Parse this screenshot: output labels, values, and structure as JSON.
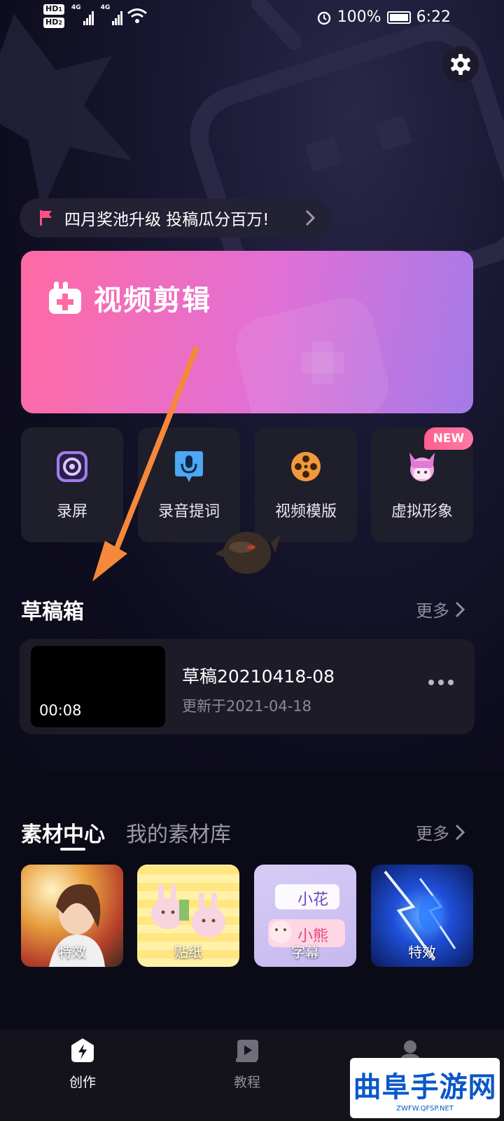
{
  "status_bar": {
    "hd1": "HD",
    "hd1_sub": "1",
    "hd2": "HD",
    "hd2_sub": "2",
    "net1": "4G",
    "net2": "4G",
    "battery": "100%",
    "time": "6:22"
  },
  "banner": {
    "text": "四月奖池升级 投稿瓜分百万!"
  },
  "edit_card": {
    "title": "视频剪辑"
  },
  "tools": [
    {
      "label": "录屏",
      "icon": "screen-record-icon"
    },
    {
      "label": "录音提词",
      "icon": "microphone-icon"
    },
    {
      "label": "视频模版",
      "icon": "film-reel-icon"
    },
    {
      "label": "虚拟形象",
      "icon": "avatar-icon",
      "badge": "NEW"
    }
  ],
  "drafts": {
    "title": "草稿箱",
    "more": "更多",
    "items": [
      {
        "name": "草稿20210418-08",
        "updated": "更新于2021-04-18",
        "duration": "00:08"
      }
    ]
  },
  "materials": {
    "tab_active": "素材中心",
    "tab_inactive": "我的素材库",
    "more": "更多",
    "items": [
      {
        "label": "特效"
      },
      {
        "label": "贴纸"
      },
      {
        "label": "字幕"
      },
      {
        "label": "特效"
      }
    ],
    "sticker_text_1": "小花",
    "sticker_text_2": "小熊"
  },
  "bottom_nav": [
    {
      "label": "创作",
      "icon": "lightning-icon",
      "active": true
    },
    {
      "label": "教程",
      "icon": "play-book-icon",
      "active": false
    }
  ],
  "watermark": {
    "text": "曲阜手游网",
    "sub": "ZWFW.QFSP.NET"
  },
  "colors": {
    "accent_pink": "#ff6aa4",
    "accent_purple": "#a47be8",
    "arrow_orange": "#f5883a",
    "badge_pink": "#ff5f8a"
  }
}
